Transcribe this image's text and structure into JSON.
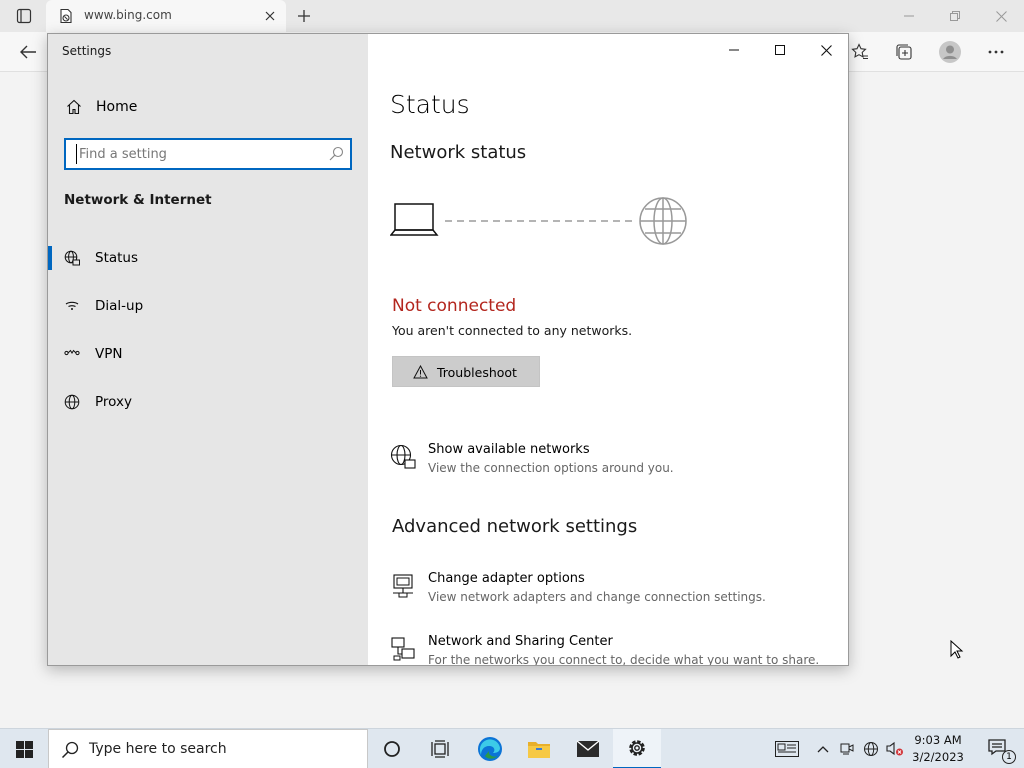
{
  "browser": {
    "tab_title": "www.bing.com"
  },
  "settings": {
    "window_title": "Settings",
    "home_label": "Home",
    "search_placeholder": "Find a setting",
    "section_label": "Network & Internet",
    "nav": [
      {
        "label": "Status",
        "icon": "status-globe-icon",
        "selected": true
      },
      {
        "label": "Dial-up",
        "icon": "dial-up-icon",
        "selected": false
      },
      {
        "label": "VPN",
        "icon": "vpn-icon",
        "selected": false
      },
      {
        "label": "Proxy",
        "icon": "proxy-globe-icon",
        "selected": false
      }
    ],
    "main": {
      "title": "Status",
      "network_status_heading": "Network status",
      "connection_status": "Not connected",
      "connection_description": "You aren't connected to any networks.",
      "troubleshoot_label": "Troubleshoot",
      "show_networks": {
        "title": "Show available networks",
        "description": "View the connection options around you."
      },
      "advanced_heading": "Advanced network settings",
      "advanced_items": [
        {
          "title": "Change adapter options",
          "description": "View network adapters and change connection settings."
        },
        {
          "title": "Network and Sharing Center",
          "description": "For the networks you connect to, decide what you want to share."
        }
      ]
    },
    "colors": {
      "accent": "#0067c0",
      "error": "#b3261e",
      "sidebar_bg": "#e6e6e6"
    }
  },
  "taskbar": {
    "search_placeholder": "Type here to search",
    "time": "9:03 AM",
    "date": "3/2/2023",
    "notification_count": "1"
  }
}
